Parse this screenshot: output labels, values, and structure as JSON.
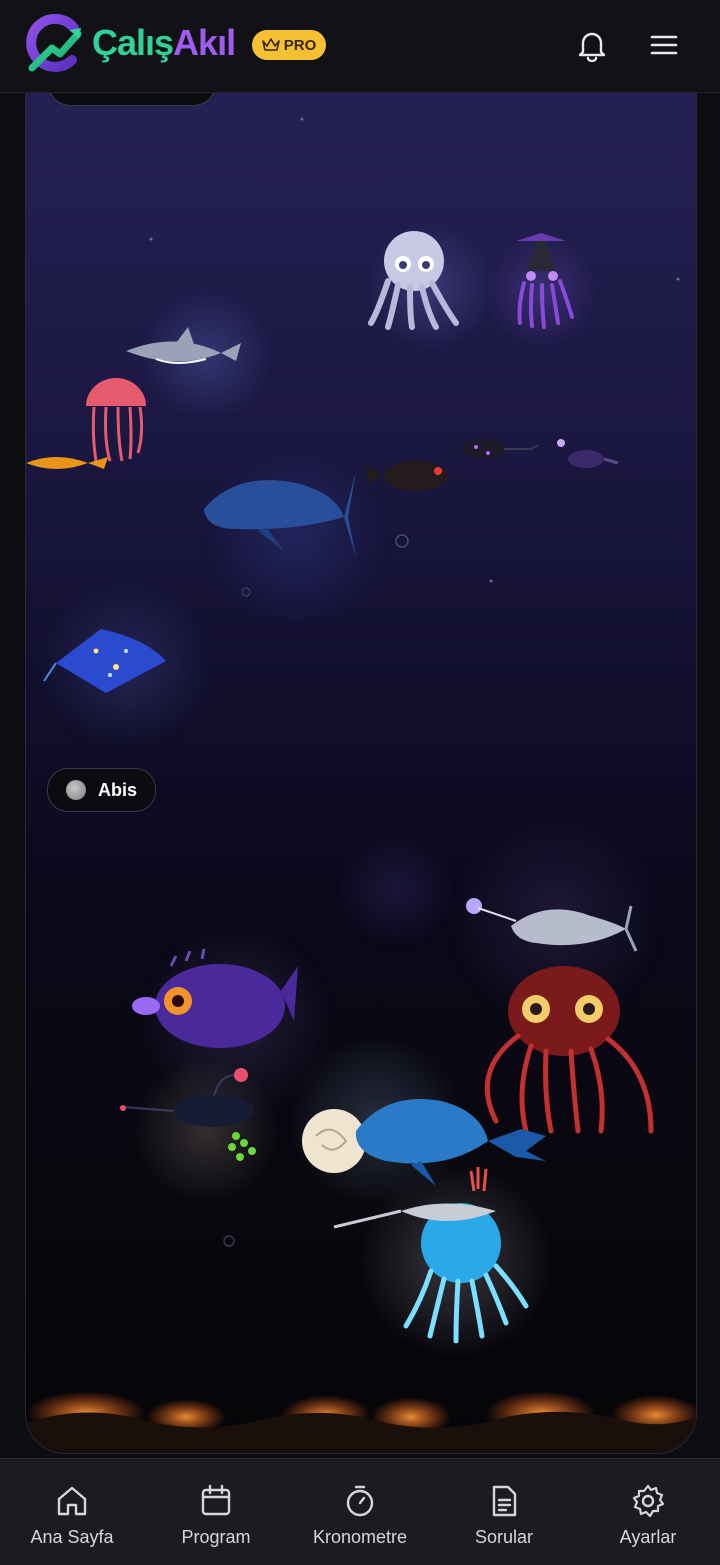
{
  "app": {
    "brand_part1": "Çalış",
    "brand_part2": "Akıl",
    "badge": "PRO"
  },
  "header_icons": [
    "bell-icon",
    "menu-icon"
  ],
  "aquarium": {
    "zones": [
      {
        "label": "Abis"
      }
    ],
    "creatures": [
      "octopus",
      "squid",
      "shark",
      "jellyfish",
      "goldfish",
      "whale",
      "black-fish",
      "anglerfish",
      "anglerfish-small",
      "manta-ray",
      "narwhal",
      "red-octopus",
      "purple-anglerfish",
      "black-anglerfish",
      "blue-whale",
      "nautilus",
      "cyan-jellyfish",
      "swordfish"
    ]
  },
  "bottom_nav": [
    {
      "label": "Ana Sayfa",
      "icon": "home-icon"
    },
    {
      "label": "Program",
      "icon": "calendar-icon"
    },
    {
      "label": "Kronometre",
      "icon": "stopwatch-icon"
    },
    {
      "label": "Sorular",
      "icon": "document-icon"
    },
    {
      "label": "Ayarlar",
      "icon": "gear-icon"
    }
  ],
  "colors": {
    "brand_green": "#2fd39a",
    "brand_purple": "#a05cf0",
    "pro_gold": "#f5c132",
    "background": "#0d0d12"
  }
}
